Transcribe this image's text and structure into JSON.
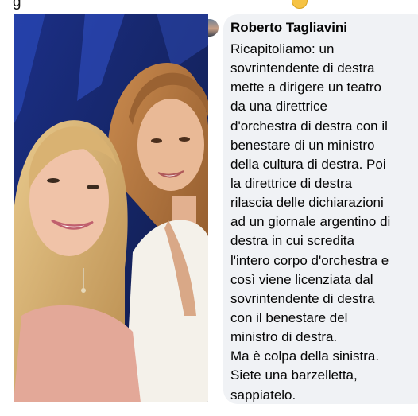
{
  "comment": {
    "author": "Roberto Tagliavini",
    "lines": [
      "Ricapitoliamo: un",
      "sovrintendente di destra",
      "mette a dirigere un teatro",
      "da una direttrice",
      "d'orchestra di destra con il",
      "benestare di un ministro",
      "della cultura di destra. Poi",
      "la direttrice di destra",
      "rilascia delle dichiarazioni",
      "ad un giornale argentino di",
      "destra in cui scredita",
      "l'intero corpo d'orchestra e",
      "così viene licenziata dal",
      "sovrintendente di destra",
      "con il benestare del",
      "ministro di destra.",
      "Ma è colpa della sinistra.",
      "Siete una barzelletta,",
      "sappiatelo."
    ]
  },
  "colors": {
    "bubble": "#f0f2f5",
    "text": "#050505",
    "photo_backdrop": "#1a2a6e"
  },
  "icons": {
    "avatar": "profile-avatar",
    "reaction": "emoji-icon"
  }
}
